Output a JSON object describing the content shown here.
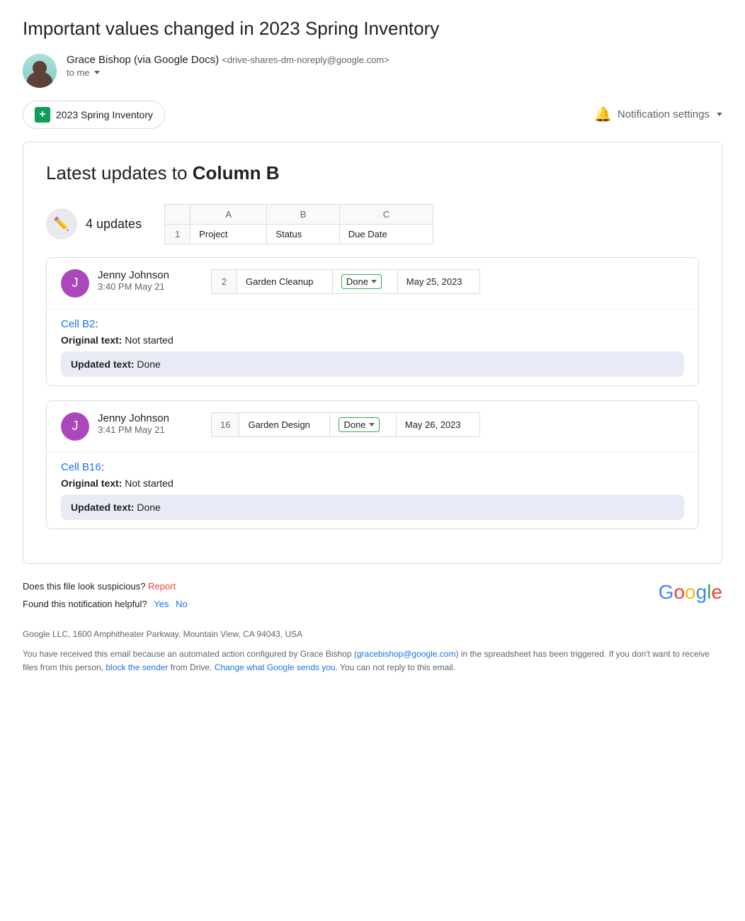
{
  "email": {
    "title": "Important values changed in 2023 Spring Inventory",
    "sender": {
      "name": "Grace Bishop (via Google Docs)",
      "email": "<drive-shares-dm-noreply@google.com>",
      "to": "to me"
    },
    "spreadsheet_btn": "2023 Spring Inventory",
    "notification_btn": "Notification settings"
  },
  "card": {
    "title_prefix": "Latest updates to ",
    "title_bold": "Column B",
    "updates_count": "4 updates",
    "table_headers": {
      "col_a": "A",
      "col_b": "B",
      "col_c": "C"
    },
    "table_row1": {
      "row_num": "1",
      "col_a": "Project",
      "col_b": "Status",
      "col_c": "Due Date"
    }
  },
  "updates": [
    {
      "user_initial": "J",
      "user_name": "Jenny Johnson",
      "user_time": "3:40 PM May 21",
      "row_num": "2",
      "col_a": "Garden Cleanup",
      "col_b_badge": "Done",
      "col_c": "May 25, 2023",
      "cell_link": "Cell B2",
      "original_label": "Original text:",
      "original_text": "Not started",
      "updated_label": "Updated text:",
      "updated_text": "Done"
    },
    {
      "user_initial": "J",
      "user_name": "Jenny Johnson",
      "user_time": "3:41 PM May 21",
      "row_num": "16",
      "col_a": "Garden Design",
      "col_b_badge": "Done",
      "col_c": "May 26, 2023",
      "cell_link": "Cell B16",
      "original_label": "Original text:",
      "original_text": "Not started",
      "updated_label": "Updated text:",
      "updated_text": "Done"
    }
  ],
  "footer": {
    "suspicious_text": "Does this file look suspicious?",
    "report_link": "Report",
    "helpful_text": "Found this notification helpful?",
    "yes_link": "Yes",
    "no_link": "No",
    "google_logo": "Google",
    "address": "Google LLC, 1600 Amphitheater Parkway, Mountain View, CA 94043, USA",
    "legal_text": "You have received this email because an automated action configured by Grace Bishop (gracebishop@google.com) in the spreadsheet has been triggered. If you don't want to receive files from this person, block the sender from Drive. Change what Google sends you. You can not reply to this email.",
    "legal_email_link": "gracebishop@google.com",
    "block_link": "block the sender",
    "change_link": "Change what Google sends you."
  }
}
